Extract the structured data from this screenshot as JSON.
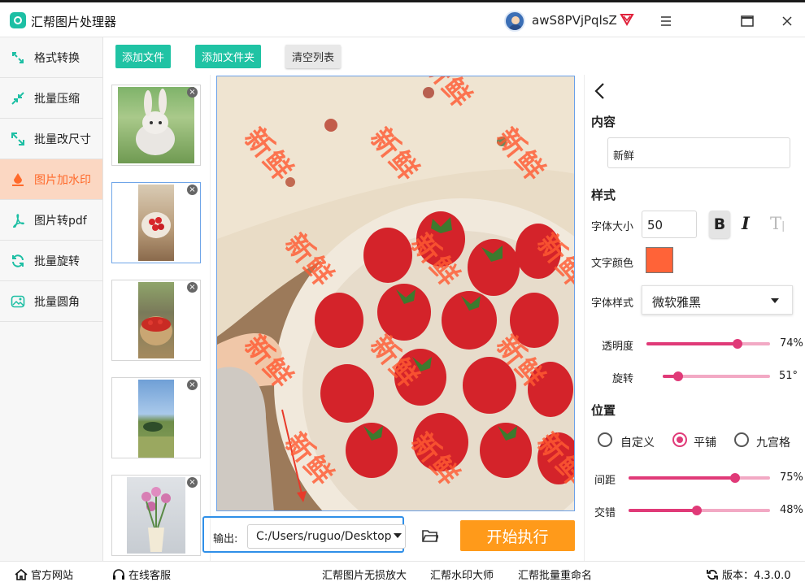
{
  "app": {
    "title": "汇帮图片处理器",
    "username": "awS8PVjPqlsZ"
  },
  "window_controls": [
    "menu-icon",
    "maximize-icon",
    "close-icon"
  ],
  "sidebar": {
    "items": [
      {
        "label": "格式转换",
        "icon": "format-convert-icon",
        "active": false
      },
      {
        "label": "批量压缩",
        "icon": "compress-icon",
        "active": false
      },
      {
        "label": "批量改尺寸",
        "icon": "resize-icon",
        "active": false
      },
      {
        "label": "图片加水印",
        "icon": "watermark-icon",
        "active": true
      },
      {
        "label": "图片转pdf",
        "icon": "pdf-icon",
        "active": false
      },
      {
        "label": "批量旋转",
        "icon": "rotate-icon",
        "active": false
      },
      {
        "label": "批量圆角",
        "icon": "round-corner-icon",
        "active": false
      }
    ]
  },
  "toolbar": {
    "add_file": "添加文件",
    "add_folder": "添加文件夹",
    "clear_list": "清空列表"
  },
  "thumbnails": [
    {
      "subject": "rabbit",
      "selected": false
    },
    {
      "subject": "strawberry-plate",
      "selected": true
    },
    {
      "subject": "strawberry-basket",
      "selected": false
    },
    {
      "subject": "landscape",
      "selected": false
    },
    {
      "subject": "tulips",
      "selected": false
    }
  ],
  "preview": {
    "watermark_text": "新鲜"
  },
  "output": {
    "label": "输出:",
    "path": "C:/Users/ruguo/Desktop",
    "start_button": "开始执行"
  },
  "panel": {
    "content_title": "内容",
    "text_value": "新鲜",
    "style_title": "样式",
    "font_size_label": "字体大小",
    "font_size": "50",
    "bold": "B",
    "italic": "I",
    "strike": "T",
    "text_color_label": "文字颜色",
    "text_color": "#ff6338",
    "font_style_label": "字体样式",
    "font_family": "微软雅黑",
    "opacity_label": "透明度",
    "opacity": 0.74,
    "opacity_text": "74%",
    "rotate_label": "旋转",
    "rotate": 51,
    "rotate_text": "51°",
    "position_title": "位置",
    "position_options": [
      "自定义",
      "平铺",
      "九宫格"
    ],
    "position_selected": "平铺",
    "spacing_label": "间距",
    "spacing": 0.75,
    "spacing_text": "75%",
    "stagger_label": "交错",
    "stagger": 0.48,
    "stagger_text": "48%"
  },
  "footer": {
    "website": "官方网站",
    "service": "在线客服",
    "link1": "汇帮图片无损放大",
    "link2": "汇帮水印大师",
    "link3": "汇帮批量重命名",
    "version": "版本：4.3.0.0"
  },
  "colors": {
    "accent_green": "#20c3a4",
    "accent_pink": "#e03a78",
    "accent_orange": "#ff9a1a",
    "active_nav_bg": "#fbd7c2"
  }
}
